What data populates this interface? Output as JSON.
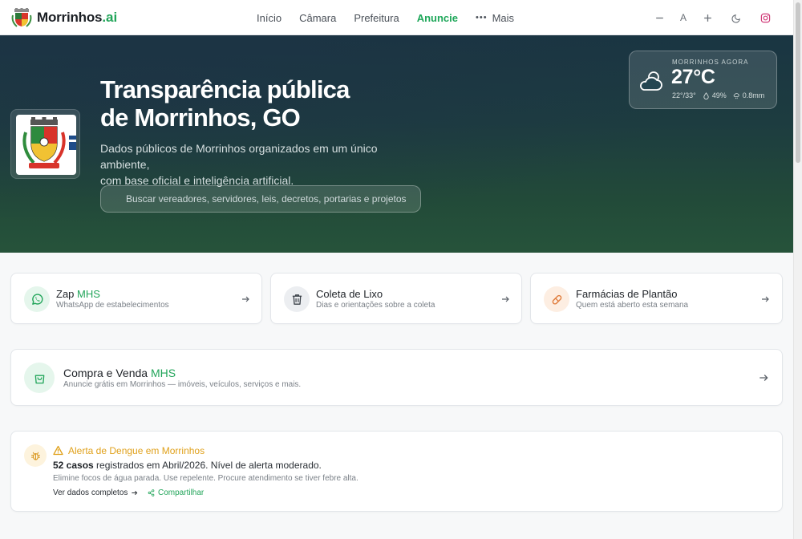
{
  "brand": {
    "name": "Morrinhos",
    "suffix": ".ai"
  },
  "nav": {
    "items": [
      {
        "label": "Início"
      },
      {
        "label": "Câmara"
      },
      {
        "label": "Prefeitura"
      },
      {
        "label": "Anuncie",
        "active": true
      },
      {
        "label": "Mais"
      }
    ]
  },
  "tools": {
    "font_label": "A"
  },
  "hero": {
    "title_line1": "Transparência pública",
    "title_line2": "de Morrinhos, GO",
    "subtitle_line1": "Dados públicos de Morrinhos organizados em um único ambiente,",
    "subtitle_line2": "com base oficial e inteligência artificial.",
    "search_placeholder": "Buscar vereadores, servidores, leis, decretos, portarias e projetos"
  },
  "weather": {
    "label": "MORRINHOS AGORA",
    "temperature": "27°C",
    "range": "22°/33°",
    "humidity": "49%",
    "rain": "0.8mm"
  },
  "quick_cards": [
    {
      "title": "Zap",
      "title_accent": "MHS",
      "desc": "WhatsApp de estabelecimentos",
      "icon": "whatsapp-icon"
    },
    {
      "title": "Coleta de Lixo",
      "title_accent": "",
      "desc": "Dias e orientações sobre a coleta",
      "icon": "trash-icon"
    },
    {
      "title": "Farmácias de Plantão",
      "title_accent": "",
      "desc": "Quem está aberto esta semana",
      "icon": "pill-icon"
    }
  ],
  "marketplace": {
    "title": "Compra e Venda",
    "title_accent": "MHS",
    "desc": "Anuncie grátis em Morrinhos — imóveis, veículos, serviços e mais."
  },
  "alert": {
    "title": "Alerta de Dengue em Morrinhos",
    "cases": "52 casos",
    "main_rest": " registrados em Abril/2026. Nível de alerta moderado.",
    "sub": "Elimine focos de água parada. Use repelente. Procure atendimento se tiver febre alta.",
    "link_label": "Ver dados completos",
    "share_label": "Compartilhar"
  },
  "colors": {
    "accent": "#22a55a",
    "warning": "#e0a11b",
    "hero_top": "#1a3542",
    "hero_bottom": "#26533a"
  }
}
